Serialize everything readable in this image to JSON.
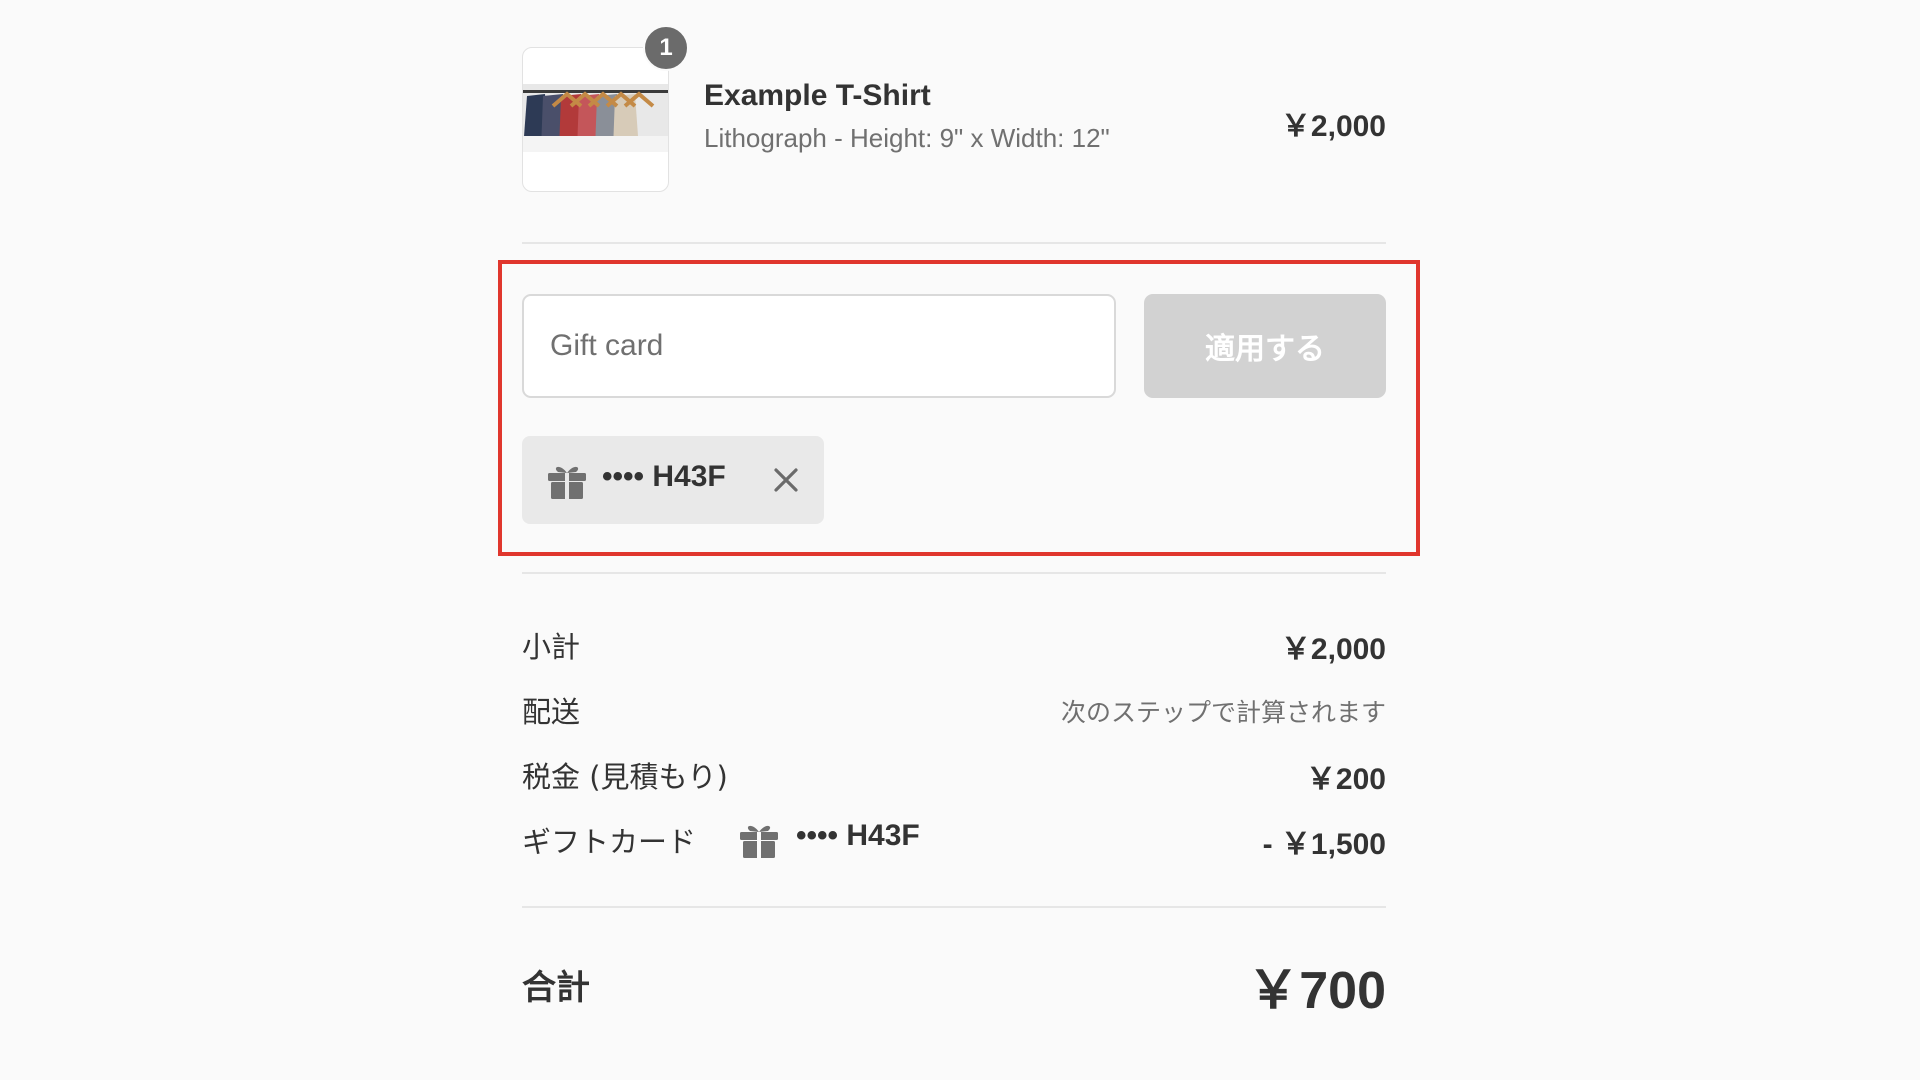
{
  "product": {
    "quantity_badge": "1",
    "name": "Example T-Shirt",
    "variant": "Lithograph - Height: 9\" x Width: 12\"",
    "price": "￥2,000",
    "thumbnail_icon": "product-thumbnail"
  },
  "gift_card": {
    "input_placeholder": "Gift card",
    "input_value": "",
    "apply_label": "適用する",
    "applied_code": "•••• H43F",
    "applied_icon": "gift-icon",
    "remove_icon": "close-icon"
  },
  "summary": {
    "subtotal_label": "小計",
    "subtotal_value": "￥2,000",
    "shipping_label": "配送",
    "shipping_value": "次のステップで計算されます",
    "tax_label": "税金 (見積もり)",
    "tax_value": "￥200",
    "giftcard_label": "ギフトカード",
    "giftcard_code": "•••• H43F",
    "giftcard_value": "- ￥1,500",
    "total_label": "合計",
    "total_value": "￥700"
  },
  "colors": {
    "highlight_border": "#e0362d",
    "badge": "#6b6b6b",
    "apply_button_disabled": "#d2d2d2",
    "tag_background": "#e9e9e9"
  }
}
